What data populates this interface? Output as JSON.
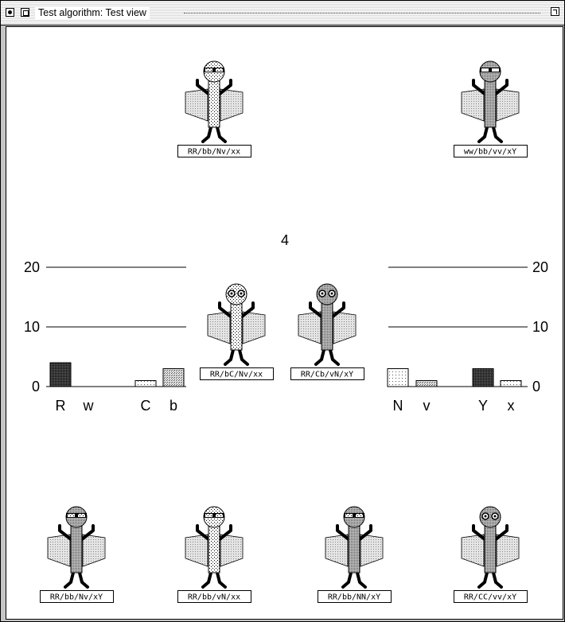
{
  "window": {
    "title": "Test algorithm: Test view",
    "generation_count": "4"
  },
  "creatures": [
    {
      "label": "RR/bb/Nv/xx",
      "body": "dots",
      "eyes": "band"
    },
    {
      "label": "ww/bb/vv/xY",
      "body": "gray",
      "eyes": "white-band"
    },
    {
      "label": "RR/bC/Nv/xx",
      "body": "dots",
      "eyes": "dots"
    },
    {
      "label": "RR/Cb/vN/xY",
      "body": "gray",
      "eyes": "dots"
    },
    {
      "label": "RR/bb/Nv/xY",
      "body": "gray",
      "eyes": "band"
    },
    {
      "label": "RR/bb/vN/xx",
      "body": "dots",
      "eyes": "band"
    },
    {
      "label": "RR/bb/NN/xY",
      "body": "gray",
      "eyes": "band"
    },
    {
      "label": "RR/CC/vv/xY",
      "body": "gray",
      "eyes": "dots"
    }
  ],
  "chart_data": [
    {
      "type": "bar",
      "title": "",
      "categories": [
        "R",
        "w",
        "C",
        "b"
      ],
      "values": [
        4,
        0,
        1,
        3
      ],
      "yticks": [
        "0",
        "10",
        "20"
      ],
      "ylim": [
        0,
        20
      ],
      "fills": [
        "dark",
        "none",
        "light",
        "medium"
      ]
    },
    {
      "type": "bar",
      "title": "",
      "categories": [
        "N",
        "v",
        "Y",
        "x"
      ],
      "values": [
        3,
        1,
        3,
        1
      ],
      "yticks": [
        "0",
        "10",
        "20"
      ],
      "ylim": [
        0,
        20
      ],
      "fills": [
        "light",
        "medium",
        "dark",
        "light"
      ]
    }
  ]
}
